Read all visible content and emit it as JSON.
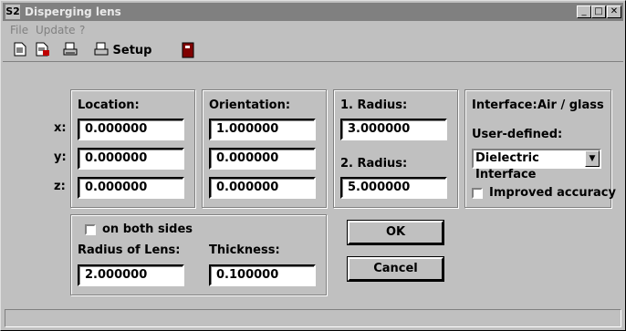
{
  "window": {
    "title": "Disperging lens",
    "app_icon": "S2"
  },
  "menu": {
    "file": "File",
    "update": "Update",
    "help": "?"
  },
  "toolbar": {
    "setup_label": "Setup"
  },
  "axes": {
    "x": "x:",
    "y": "y:",
    "z": "z:"
  },
  "location": {
    "label": "Location:",
    "x": "0.000000",
    "y": "0.000000",
    "z": "0.000000"
  },
  "orientation": {
    "label": "Orientation:",
    "x": "1.000000",
    "y": "0.000000",
    "z": "0.000000"
  },
  "radius1": {
    "label": "1. Radius:",
    "value": "3.000000"
  },
  "radius2": {
    "label": "2. Radius:",
    "value": "5.000000"
  },
  "interface": {
    "label": "Interface:",
    "value": "Air / glass",
    "user_defined_label": "User-defined:",
    "selected": "Dielectric Interface",
    "improved_accuracy": "Improved accuracy"
  },
  "lens": {
    "both_sides": "on both sides",
    "radius_label": "Radius of Lens:",
    "radius_value": "2.000000",
    "thickness_label": "Thickness:",
    "thickness_value": "0.100000"
  },
  "buttons": {
    "ok": "OK",
    "cancel": "Cancel"
  }
}
